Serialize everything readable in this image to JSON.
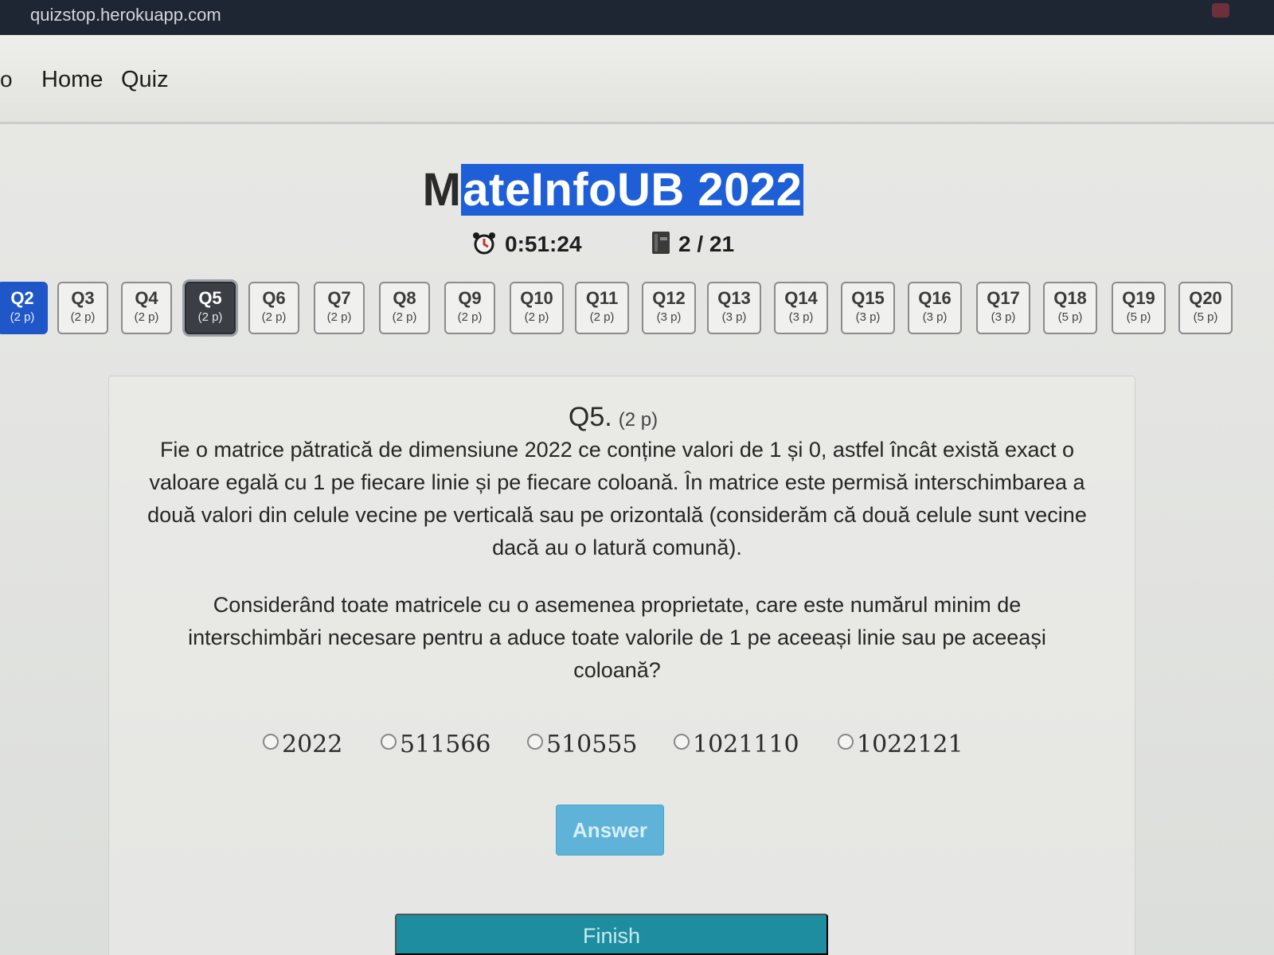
{
  "browser": {
    "url": "quizstop.herokuapp.com"
  },
  "navbar": {
    "brand": "o",
    "links": [
      "Home",
      "Quiz"
    ]
  },
  "quiz": {
    "title_plain": "M",
    "title_selected": "ateInfoUB 2022",
    "timer": "0:51:24",
    "progress": "2 / 21"
  },
  "question_nav": [
    {
      "label": "Q2",
      "points": "(2 p)",
      "state": "answered"
    },
    {
      "label": "Q3",
      "points": "(2 p)",
      "state": "default"
    },
    {
      "label": "Q4",
      "points": "(2 p)",
      "state": "default"
    },
    {
      "label": "Q5",
      "points": "(2 p)",
      "state": "current"
    },
    {
      "label": "Q6",
      "points": "(2 p)",
      "state": "default"
    },
    {
      "label": "Q7",
      "points": "(2 p)",
      "state": "default"
    },
    {
      "label": "Q8",
      "points": "(2 p)",
      "state": "default"
    },
    {
      "label": "Q9",
      "points": "(2 p)",
      "state": "default"
    },
    {
      "label": "Q10",
      "points": "(2 p)",
      "state": "default"
    },
    {
      "label": "Q11",
      "points": "(2 p)",
      "state": "default"
    },
    {
      "label": "Q12",
      "points": "(3 p)",
      "state": "default"
    },
    {
      "label": "Q13",
      "points": "(3 p)",
      "state": "default"
    },
    {
      "label": "Q14",
      "points": "(3 p)",
      "state": "default"
    },
    {
      "label": "Q15",
      "points": "(3 p)",
      "state": "default"
    },
    {
      "label": "Q16",
      "points": "(3 p)",
      "state": "default"
    },
    {
      "label": "Q17",
      "points": "(3 p)",
      "state": "default"
    },
    {
      "label": "Q18",
      "points": "(5 p)",
      "state": "default"
    },
    {
      "label": "Q19",
      "points": "(5 p)",
      "state": "default"
    },
    {
      "label": "Q20",
      "points": "(5 p)",
      "state": "default"
    }
  ],
  "question": {
    "number": "Q5.",
    "points": "(2 p)",
    "paragraph1": "Fie o matrice pătratică de dimensiune 2022 ce conține valori de 1 și 0, astfel încât există exact o valoare egală cu 1 pe fiecare linie și pe fiecare coloană. În matrice este permisă interschimbarea a două valori din celule vecine pe verticală sau pe orizontală (considerăm că două celule sunt vecine dacă au o latură comună).",
    "paragraph2": "Considerând toate matricele cu o asemenea proprietate, care este numărul minim de interschimbări necesare pentru a aduce toate valorile de 1 pe aceeași linie sau pe aceeași coloană?",
    "options": [
      "2022",
      "511566",
      "510555",
      "1021110",
      "1022121"
    ]
  },
  "buttons": {
    "answer": "Answer",
    "finish": "Finish"
  }
}
